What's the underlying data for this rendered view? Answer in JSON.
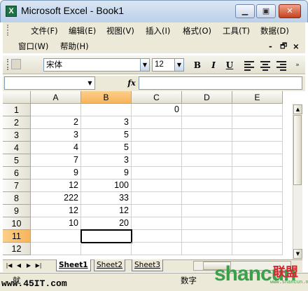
{
  "window": {
    "app_icon": "X",
    "title": "Microsoft Excel - Book1",
    "buttons": {
      "minimize": "▁",
      "restore": "▣",
      "close": "✕"
    }
  },
  "menu": {
    "row1": [
      "文件(F)",
      "编辑(E)",
      "视图(V)",
      "插入(I)",
      "格式(O)",
      "工具(T)",
      "数据(D)"
    ],
    "row2": [
      "窗口(W)",
      "帮助(H)"
    ],
    "doc_controls": {
      "minimize": "-",
      "restore": "🗗",
      "close": "×"
    }
  },
  "toolbar": {
    "font_name": "宋体",
    "font_size": "12",
    "bold": "B",
    "italic": "I",
    "underline": "U",
    "dropdown_arrow": "▼",
    "overflow": "»"
  },
  "formula_bar": {
    "name_box": "",
    "fx": "fx",
    "content": ""
  },
  "grid": {
    "columns": [
      "A",
      "B",
      "C",
      "D",
      "E"
    ],
    "rows": [
      "1",
      "2",
      "3",
      "4",
      "5",
      "6",
      "7",
      "8",
      "9",
      "10",
      "11",
      "12"
    ],
    "values": [
      [
        "",
        "",
        "0",
        "",
        ""
      ],
      [
        "2",
        "3",
        "",
        "",
        ""
      ],
      [
        "3",
        "5",
        "",
        "",
        ""
      ],
      [
        "4",
        "5",
        "",
        "",
        ""
      ],
      [
        "7",
        "3",
        "",
        "",
        ""
      ],
      [
        "9",
        "9",
        "",
        "",
        ""
      ],
      [
        "12",
        "100",
        "",
        "",
        ""
      ],
      [
        "222",
        "33",
        "",
        "",
        ""
      ],
      [
        "12",
        "12",
        "",
        "",
        ""
      ],
      [
        "10",
        "20",
        "",
        "",
        ""
      ],
      [
        "",
        "",
        "",
        "",
        ""
      ],
      [
        "",
        "",
        "",
        "",
        ""
      ]
    ],
    "active_cell": "B11"
  },
  "sheets": {
    "nav": [
      "|◀",
      "◀",
      "▶",
      "▶|"
    ],
    "tabs": [
      "Sheet1",
      "Sheet2",
      "Sheet3"
    ]
  },
  "status": {
    "left": "就",
    "mode": "数字"
  },
  "watermark": {
    "site": "www.45IT.com",
    "brand": "shancun",
    "brand_cn": "联盟",
    "brand_sub": "www.shancun.net"
  }
}
